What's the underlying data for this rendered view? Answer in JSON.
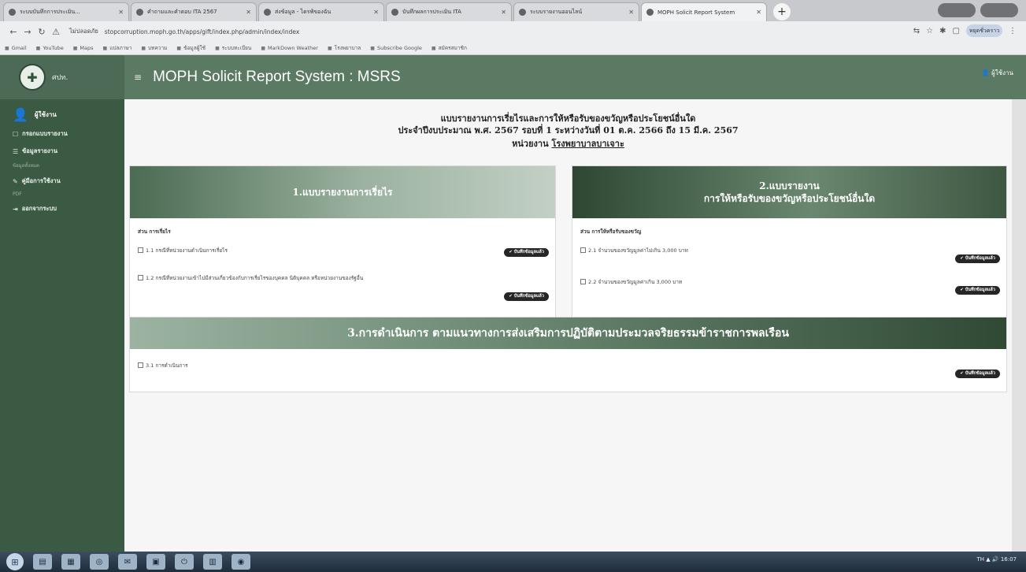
{
  "browser": {
    "tabs": [
      {
        "label": "ระบบบันทึกการประเมิน...",
        "active": false
      },
      {
        "label": "คำถามและคำตอบ ITA 2567",
        "active": false
      },
      {
        "label": "ส่งข้อมูล - ไดรฟ์ของฉัน",
        "active": false
      },
      {
        "label": "บันทึกผลการประเมิน ITA",
        "active": false
      },
      {
        "label": "ระบบรายงานออนไลน์",
        "active": false
      },
      {
        "label": "MOPH Solicit Report System",
        "active": true
      }
    ],
    "new_tab": "+",
    "url_prefix": "ไม่ปลอดภัย",
    "url": "stopcorruption.moph.go.th/apps/gift/index.php/admin/index/index",
    "profile": "หยุดชั่วคราว",
    "bookmarks": [
      "Gmail",
      "YouTube",
      "Maps",
      "แปลภาษา",
      "บทความ",
      "ข้อมูลผู้ใช้",
      "ระบบทะเบียน",
      "MarkDown Weather",
      "โรงพยาบาล",
      "Subscribe Google",
      "สมัครสมาชิก"
    ]
  },
  "sidebar": {
    "brand_text": "ศปท.",
    "user": "ผู้ใช้งาน",
    "items": [
      {
        "label": "กรอกแบบรายงาน",
        "icon": "☐",
        "sub": ""
      },
      {
        "label": "ข้อมูลรายงาน",
        "icon": "☰",
        "sub": "ข้อมูลทั้งหมด"
      },
      {
        "label": "คู่มือการใช้งาน",
        "icon": "✎",
        "sub": "PDF"
      },
      {
        "label": "ออกจากระบบ",
        "icon": "⇥",
        "sub": ""
      }
    ]
  },
  "topbar": {
    "menu_icon": "≡",
    "title": "MOPH Solicit Report System : MSRS",
    "user": "ผู้ใช้งาน"
  },
  "header": {
    "line1": "แบบรายงานการเรี่ยไรและการให้หรือรับของขวัญหรือประโยชน์อื่นใด",
    "line2": "ประจำปีงบประมาณ พ.ศ. 2567 รอบที่ 1 ระหว่างวันที่ 01 ต.ค. 2566 ถึง 15 มี.ค. 2567",
    "unit_label": "หน่วยงาน",
    "unit_name": "โรงพยาบาลบาเจาะ"
  },
  "section1": {
    "title": "1.แบบรายงานการเรี่ยไร",
    "subhead": "ส่วน การเรี่ยไร",
    "rows": [
      {
        "text": "1.1 กรณีที่หน่วยงานดำเนินการเรี่ยไร",
        "button": "บันทึกข้อมูลแล้ว"
      },
      {
        "text": "1.2 กรณีที่หน่วยงานเข้าไปมีส่วนเกี่ยวข้องกับการเรี่ยไรของบุคคล นิติบุคคล หรือหน่วยงานของรัฐอื่น",
        "button": "บันทึกข้อมูลแล้ว"
      }
    ]
  },
  "section2": {
    "title_line1": "2.แบบรายงาน",
    "title_line2": "การให้หรือรับของขวัญหรือประโยชน์อื่นใด",
    "subhead": "ส่วน การให้หรือรับของขวัญ",
    "rows": [
      {
        "text": "2.1 จำนวนของขวัญมูลค่าไม่เกิน 3,000 บาท",
        "button": "บันทึกข้อมูลแล้ว"
      },
      {
        "text": "2.2 จำนวนของขวัญมูลค่าเกิน 3,000 บาท",
        "button": "บันทึกข้อมูลแล้ว"
      }
    ]
  },
  "section3": {
    "title": "3.การดำเนินการ ตามแนวทางการส่งเสริมการปฏิบัติตามประมวลจริยธรรมข้าราชการพลเรือน",
    "rows": [
      {
        "text": "3.1 การดำเนินการ",
        "button": "บันทึกข้อมูลแล้ว"
      }
    ]
  },
  "taskbar": {
    "start": "⊞",
    "apps": [
      "▤",
      "▦",
      "◎",
      "✉",
      "▣",
      "⏻",
      "▥",
      "◉"
    ],
    "tray": "TH  ▲  🔊  16:07"
  },
  "colors": {
    "sidebar": "#3a5a44",
    "topbar": "#5a7a63",
    "pill": "#262626"
  }
}
